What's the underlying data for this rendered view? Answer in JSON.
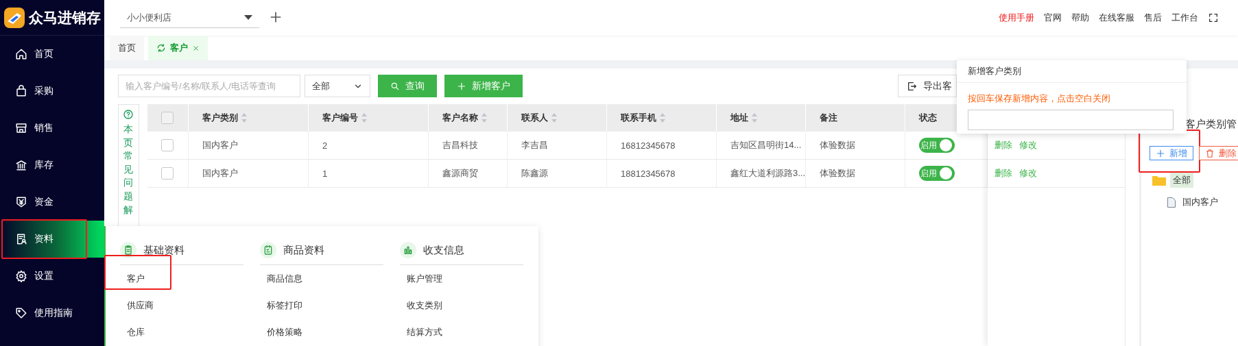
{
  "brand": {
    "name": "众马进销存"
  },
  "store_select": {
    "value": "小小便利店"
  },
  "top_links": [
    {
      "label": "使用手册",
      "kind": "accent"
    },
    {
      "label": "官网",
      "kind": "normal"
    },
    {
      "label": "帮助",
      "kind": "normal"
    },
    {
      "label": "在线客服",
      "kind": "normal"
    },
    {
      "label": "售后",
      "kind": "normal"
    },
    {
      "label": "工作台",
      "kind": "normal"
    }
  ],
  "sidebar": {
    "items": [
      {
        "label": "首页",
        "selected": false,
        "highlighted": false
      },
      {
        "label": "采购",
        "selected": false,
        "highlighted": false
      },
      {
        "label": "销售",
        "selected": false,
        "highlighted": false
      },
      {
        "label": "库存",
        "selected": false,
        "highlighted": false
      },
      {
        "label": "资金",
        "selected": false,
        "highlighted": false
      },
      {
        "label": "资料",
        "selected": true,
        "highlighted": true
      },
      {
        "label": "设置",
        "selected": false,
        "highlighted": false
      },
      {
        "label": "使用指南",
        "selected": false,
        "highlighted": false
      }
    ]
  },
  "tabs": [
    {
      "label": "首页",
      "selected": false,
      "closable": false
    },
    {
      "label": "客户",
      "selected": true,
      "closable": true
    }
  ],
  "toolbar": {
    "search": {
      "placeholder": "输入客户编号/名称/联系人/电话等查询"
    },
    "filter": {
      "value": "全部"
    },
    "buttons": [
      {
        "label": "查询",
        "kind": "search"
      },
      {
        "label": "新增客户",
        "kind": "add"
      }
    ],
    "export_button": "导出客"
  },
  "help_panel": {
    "text": "本页常见问题解"
  },
  "table": {
    "header_checked": false,
    "columns": [
      {
        "label": "客户类别",
        "sortable": true
      },
      {
        "label": "客户编号",
        "sortable": true
      },
      {
        "label": "客户名称",
        "sortable": true
      },
      {
        "label": "联系人",
        "sortable": true
      },
      {
        "label": "联系手机",
        "sortable": true
      },
      {
        "label": "地址",
        "sortable": true
      },
      {
        "label": "备注",
        "sortable": false
      },
      {
        "label": "状态",
        "sortable": false
      }
    ],
    "rows": [
      {
        "checked": false,
        "cells": [
          "国内客户",
          "2",
          "吉昌科技",
          "李吉昌",
          "16812345678",
          "吉知区昌明街14...",
          "体验数据"
        ],
        "status": {
          "label": "启用",
          "on": true
        }
      },
      {
        "checked": false,
        "cells": [
          "国内客户",
          "1",
          "鑫源商贸",
          "陈鑫源",
          "18812345678",
          "鑫红大道利源路3...",
          "体验数据"
        ],
        "status": {
          "label": "启用",
          "on": true
        }
      }
    ]
  },
  "actions_panel": {
    "rows": [
      [
        "删除",
        "修改"
      ],
      [
        "删除",
        "修改"
      ]
    ]
  },
  "category_panel": {
    "title": "客户类别管",
    "buttons": [
      {
        "label": "新增",
        "kind": "add",
        "highlighted": true
      },
      {
        "label": "删除",
        "kind": "delete",
        "highlighted": false
      }
    ],
    "tree": {
      "label": "全部",
      "selected": true,
      "children": [
        {
          "label": "国内客户",
          "selected": false
        }
      ]
    }
  },
  "popup": {
    "title": "新增客户类别",
    "hint": "按回车保存新增内容，点击空白关闭"
  },
  "mega_menu": {
    "columns": [
      {
        "title": "基础资料",
        "items": [
          {
            "label": "客户",
            "highlighted": true
          },
          {
            "label": "供应商",
            "highlighted": false
          },
          {
            "label": "仓库",
            "highlighted": false
          }
        ]
      },
      {
        "title": "商品资料",
        "items": [
          {
            "label": "商品信息",
            "highlighted": false
          },
          {
            "label": "标签打印",
            "highlighted": false
          },
          {
            "label": "价格策略",
            "highlighted": false
          }
        ]
      },
      {
        "title": "收支信息",
        "items": [
          {
            "label": "账户管理",
            "highlighted": false
          },
          {
            "label": "收支类别",
            "highlighted": false
          },
          {
            "label": "结算方式",
            "highlighted": false
          }
        ]
      }
    ]
  }
}
